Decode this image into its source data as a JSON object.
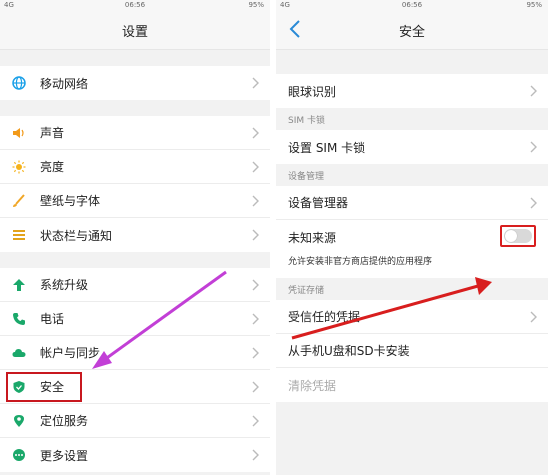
{
  "left": {
    "status": {
      "signal": "4G",
      "time": "06:56",
      "battery": "95%"
    },
    "title": "设置",
    "groups": [
      [
        {
          "label": "移动网络",
          "icon": "globe-icon",
          "color": "#1aa0e8"
        }
      ],
      [
        {
          "label": "声音",
          "icon": "speaker-icon",
          "color": "#f29a1a"
        },
        {
          "label": "亮度",
          "icon": "sun-icon",
          "color": "#f5b21b"
        },
        {
          "label": "壁纸与字体",
          "icon": "brush-icon",
          "color": "#f0a626"
        },
        {
          "label": "状态栏与通知",
          "icon": "list-icon",
          "color": "#e3a31b"
        }
      ],
      [
        {
          "label": "系统升级",
          "icon": "upgrade-arrow-icon",
          "color": "#1aa86a"
        },
        {
          "label": "电话",
          "icon": "phone-icon",
          "color": "#1aa86a"
        },
        {
          "label": "帐户与同步",
          "icon": "cloud-icon",
          "color": "#1aa86a"
        },
        {
          "label": "安全",
          "icon": "shield-icon",
          "color": "#1aa86a"
        },
        {
          "label": "定位服务",
          "icon": "location-pin-icon",
          "color": "#1aa86a"
        },
        {
          "label": "更多设置",
          "icon": "more-icon",
          "color": "#1aa86a"
        }
      ]
    ]
  },
  "right": {
    "status": {
      "signal": "4G",
      "time": "06:56",
      "battery": "95%"
    },
    "title": "安全",
    "eye": "眼球识别",
    "sim_header": "SIM 卡锁",
    "sim_lock": "设置 SIM 卡锁",
    "device_header": "设备管理",
    "device_manager": "设备管理器",
    "unknown_sources": "未知来源",
    "unknown_sources_enabled": false,
    "unknown_sources_hint": "允许安装非官方商店提供的应用程序",
    "cred_header": "凭证存储",
    "trusted_creds": "受信任的凭据",
    "install_from_storage": "从手机U盘和SD卡安装",
    "clear_creds": "清除凭据"
  },
  "colors": {
    "accent_red": "#d81e1e",
    "arrow_purple": "#c23fd6",
    "back_blue": "#2a8ad6"
  }
}
